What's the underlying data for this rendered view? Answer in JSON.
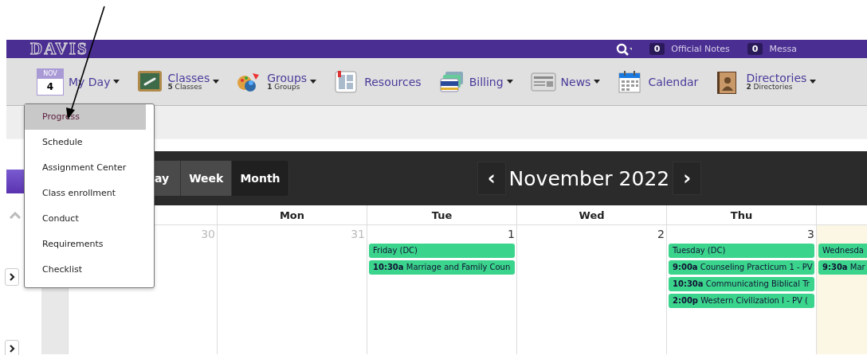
{
  "header": {
    "logo": "DAVIS",
    "notices": [
      {
        "count": "0",
        "label": "Official Notes"
      },
      {
        "count": "0",
        "label": "Messa"
      }
    ]
  },
  "nav": [
    {
      "kind": "date",
      "month": "NOV",
      "day": "4",
      "label": "My Day",
      "caret": true
    },
    {
      "kind": "classes",
      "label": "Classes",
      "count": "5",
      "sub": "Classes",
      "caret": true
    },
    {
      "kind": "groups",
      "label": "Groups",
      "count": "1",
      "sub": "Groups",
      "caret": true
    },
    {
      "kind": "resources",
      "label": "Resources",
      "caret": false
    },
    {
      "kind": "billing",
      "label": "Billing",
      "caret": true
    },
    {
      "kind": "news",
      "label": "News",
      "caret": true
    },
    {
      "kind": "calendar",
      "label": "Calendar",
      "caret": false
    },
    {
      "kind": "directories",
      "label": "Directories",
      "count": "2",
      "sub": "Directories",
      "caret": true
    }
  ],
  "dropdown": [
    {
      "label": "Progress",
      "selected": true
    },
    {
      "label": "Schedule",
      "selected": false
    },
    {
      "label": "Assignment Center",
      "selected": false
    },
    {
      "label": "Class enrollment",
      "selected": false
    },
    {
      "label": "Conduct",
      "selected": false
    },
    {
      "label": "Requirements",
      "selected": false
    },
    {
      "label": "Checklist",
      "selected": false
    }
  ],
  "calendar": {
    "views": [
      {
        "label": "ay",
        "selected": false
      },
      {
        "label": "Week",
        "selected": false
      },
      {
        "label": "Month",
        "selected": true
      }
    ],
    "prev": "‹",
    "title": "November 2022",
    "next": "›",
    "days": [
      {
        "date": "30",
        "muted": true,
        "today": false
      },
      {
        "header": "Mon",
        "date": "31",
        "muted": true,
        "today": false
      },
      {
        "header": "Tue",
        "date": "1",
        "muted": false,
        "today": false,
        "events": [
          {
            "title": "Friday (DC)"
          },
          {
            "time": "10:30a",
            "title": "Marriage and Family Coun"
          }
        ]
      },
      {
        "header": "Wed",
        "date": "2",
        "muted": false,
        "today": false
      },
      {
        "header": "Thu",
        "date": "3",
        "muted": false,
        "today": false,
        "events": [
          {
            "title": "Tuesday (DC)"
          },
          {
            "time": "9:00a",
            "title": "Counseling Practicum 1 - PV"
          },
          {
            "time": "10:30a",
            "title": "Communicating Biblical Tr"
          },
          {
            "time": "2:00p",
            "title": "Western Civilization I - PV ("
          }
        ]
      },
      {
        "today": true,
        "events": [
          {
            "title": "Wednesda"
          },
          {
            "time": "9:30a",
            "title": "Mar"
          }
        ]
      }
    ]
  }
}
